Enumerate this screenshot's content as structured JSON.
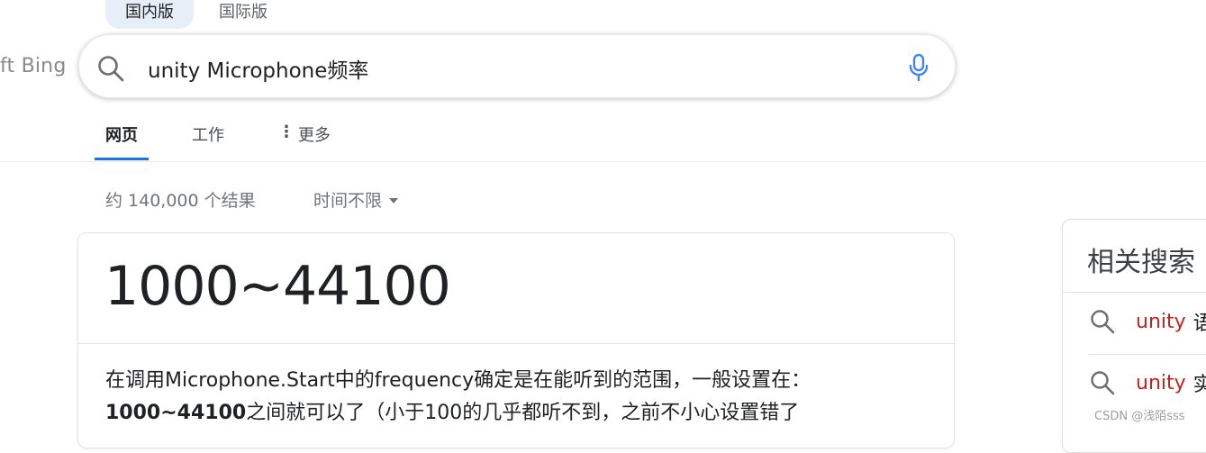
{
  "region_tabs": [
    {
      "label": "国内版",
      "active": true
    },
    {
      "label": "国际版",
      "active": false
    }
  ],
  "logo_text": "ft Bing",
  "search": {
    "value": "unity Microphone频率",
    "search_icon": "search-icon",
    "mic_icon": "microphone-icon"
  },
  "nav": {
    "items": [
      {
        "label": "网页",
        "active": true
      },
      {
        "label": "工作",
        "active": false
      }
    ],
    "more_label": "更多"
  },
  "results": {
    "count_text": "约 140,000 个结果",
    "time_filter": "时间不限"
  },
  "answer": {
    "value": "1000~44100",
    "snippet_line1": "在调用Microphone.Start中的frequency确定是在能听到的范围，一般设置在：",
    "snippet_bold": "1000~44100",
    "snippet_line2_rest": "之间就可以了（小于100的几乎都听不到，之前不小心设置错了"
  },
  "related": {
    "title": "相关搜索",
    "items": [
      {
        "keyword": "unity",
        "rest": "语"
      },
      {
        "keyword": "unity",
        "rest": "实"
      }
    ]
  },
  "watermark": "CSDN @浅陌sss",
  "colors": {
    "accent_blue": "#1a73e8",
    "mic_blue": "#4285f4",
    "related_keyword_red": "#c5221f",
    "active_region_bg": "#e6eef7"
  }
}
